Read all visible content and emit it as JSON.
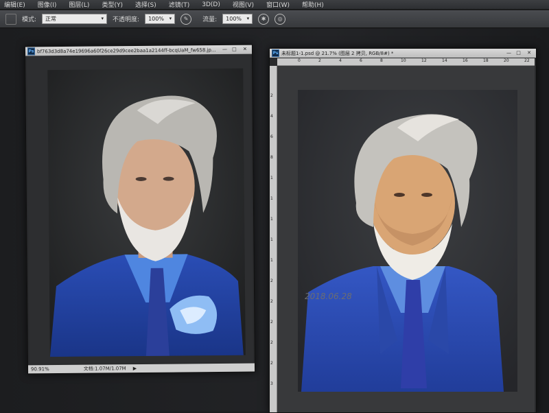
{
  "menu": [
    "编辑(E)",
    "图像(I)",
    "图层(L)",
    "类型(Y)",
    "选择(S)",
    "滤镜(T)",
    "3D(D)",
    "视图(V)",
    "窗口(W)",
    "帮助(H)"
  ],
  "options": {
    "mode_label": "模式:",
    "mode_value": "正常",
    "opacity_label": "不透明度:",
    "opacity_value": "100%",
    "flow_label": "流量:",
    "flow_value": "100%"
  },
  "doc1": {
    "title": "bf763d3d8a74e19696a60f26ce29d9cee2baa1a2144ff-bcqUaM_fw658.jp...",
    "zoom": "90.91%",
    "status": "文档:1.07M/1.07M"
  },
  "doc2": {
    "title": "未标题1-1.psd @ 21.7% (图层 2 拷贝, RGB/8#) *",
    "ruler_top": [
      "0",
      "2",
      "4",
      "6",
      "8",
      "10",
      "12",
      "14",
      "16",
      "18",
      "20",
      "22"
    ],
    "ruler_left": [
      "2",
      "4",
      "6",
      "8",
      "1",
      "1",
      "1",
      "1",
      "1",
      "2",
      "2",
      "2",
      "2",
      "2",
      "3"
    ],
    "signature": "2018.06.28"
  },
  "colors": {
    "suit_blue": "#2d52b8",
    "shirt_blue": "#4f86e0",
    "hair_grey": "#b9b7b2"
  }
}
